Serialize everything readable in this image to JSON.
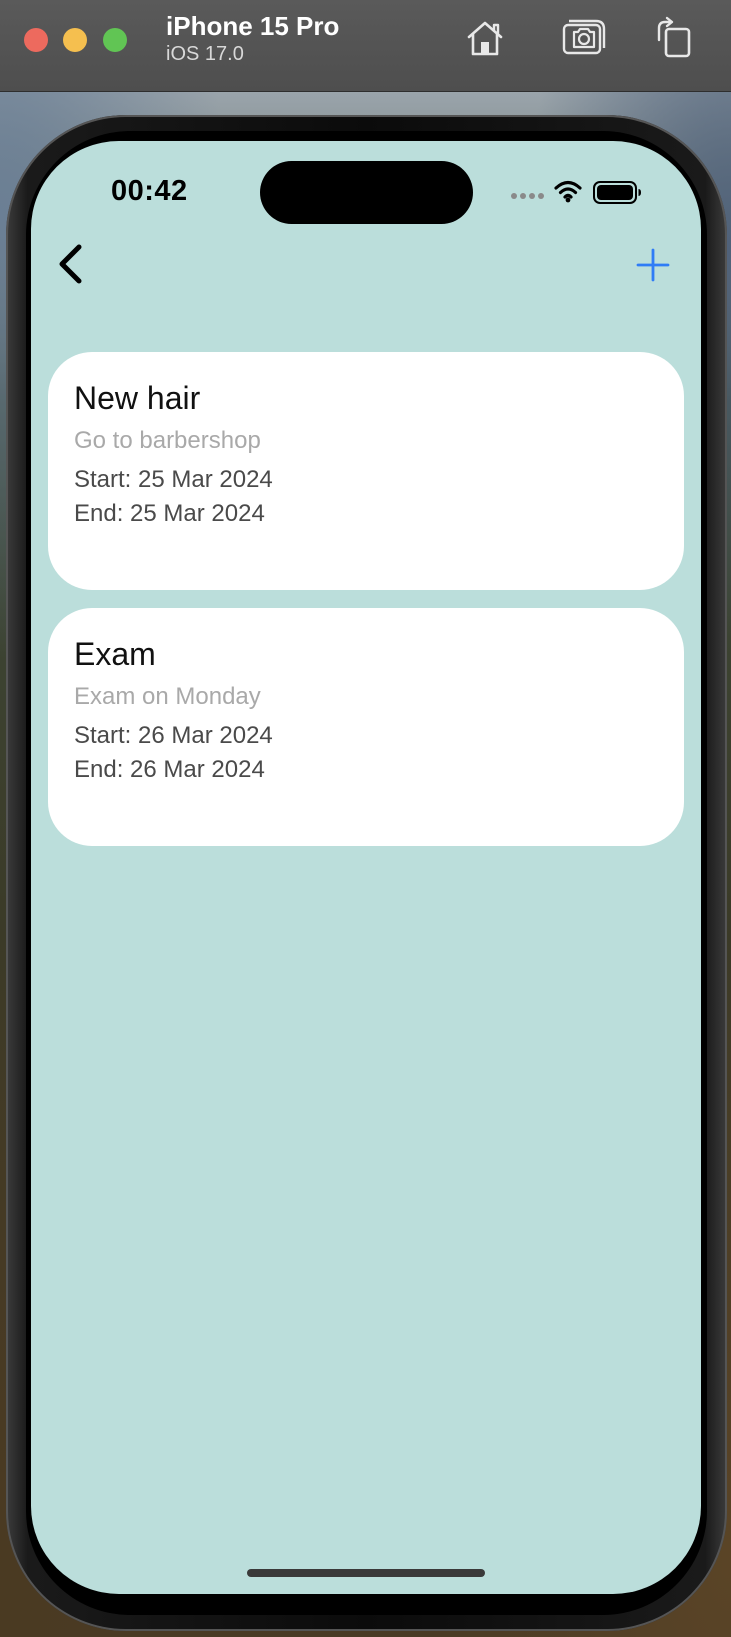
{
  "simulator": {
    "device_name": "iPhone 15 Pro",
    "os_version": "iOS 17.0",
    "toolbar_icons": [
      "home-icon",
      "screenshot-icon",
      "rotate-icon"
    ]
  },
  "status_bar": {
    "time": "00:42",
    "icons": [
      "cellular-dots-icon",
      "wifi-icon",
      "battery-icon"
    ]
  },
  "nav": {
    "back_icon": "chevron-left-icon",
    "add_icon": "plus-icon",
    "accent_color": "#2f7cf6"
  },
  "screen": {
    "background_color": "#bbdedb"
  },
  "events": [
    {
      "title": "New hair",
      "description": "Go to barbershop",
      "start": "Start: 25 Mar 2024",
      "end": "End: 25 Mar 2024"
    },
    {
      "title": "Exam",
      "description": "Exam on Monday",
      "start": "Start: 26 Mar 2024",
      "end": "End: 26 Mar 2024"
    }
  ]
}
